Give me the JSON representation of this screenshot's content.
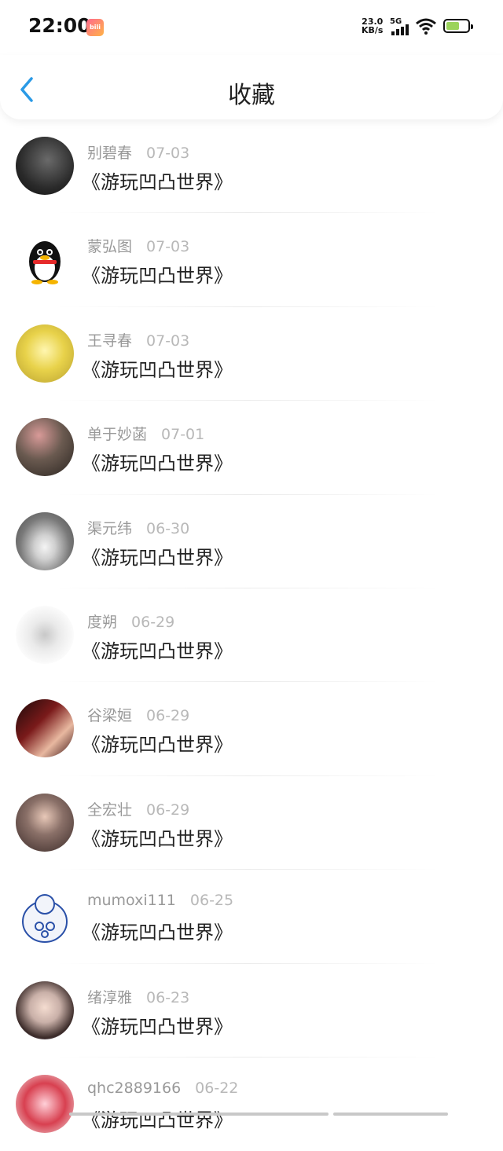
{
  "status_bar": {
    "time": "22:00",
    "speed_value": "23.0",
    "speed_unit": "KB/s",
    "network": "5G",
    "icons": [
      "app-badge-icon",
      "signal-icon",
      "wifi-icon",
      "battery-icon"
    ]
  },
  "header": {
    "title": "收藏",
    "back_icon": "chevron-left-icon",
    "accent_color": "#2a9ae6"
  },
  "favorites": [
    {
      "name": "别碧春",
      "date": "07-03",
      "title": "《游玩凹凸世界》",
      "avatar_color": "#3a3a3a"
    },
    {
      "name": "蒙弘图",
      "date": "07-03",
      "title": "《游玩凹凸世界》",
      "avatar_color": "#ffffff"
    },
    {
      "name": "王寻春",
      "date": "07-03",
      "title": "《游玩凹凸世界》",
      "avatar_color": "#e8d24a"
    },
    {
      "name": "单于妙菡",
      "date": "07-01",
      "title": "《游玩凹凸世界》",
      "avatar_color": "#6a5a50"
    },
    {
      "name": "渠元纬",
      "date": "06-30",
      "title": "《游玩凹凸世界》",
      "avatar_color": "#8a8a8a"
    },
    {
      "name": "度朔",
      "date": "06-29",
      "title": "《游玩凹凸世界》",
      "avatar_color": "#f2f2f2"
    },
    {
      "name": "谷梁姮",
      "date": "06-29",
      "title": "《游玩凹凸世界》",
      "avatar_color": "#7a1a1a"
    },
    {
      "name": "全宏壮",
      "date": "06-29",
      "title": "《游玩凹凸世界》",
      "avatar_color": "#8a7068"
    },
    {
      "name": "mumoxi111",
      "date": "06-25",
      "title": "《游玩凹凸世界》",
      "avatar_color": "#e9eef8"
    },
    {
      "name": "绪淳雅",
      "date": "06-23",
      "title": "《游玩凹凸世界》",
      "avatar_color": "#c9b0a8"
    },
    {
      "name": "qhc2889166",
      "date": "06-22",
      "title": "《游玩凹凸世界》",
      "avatar_color": "#d84050"
    }
  ]
}
